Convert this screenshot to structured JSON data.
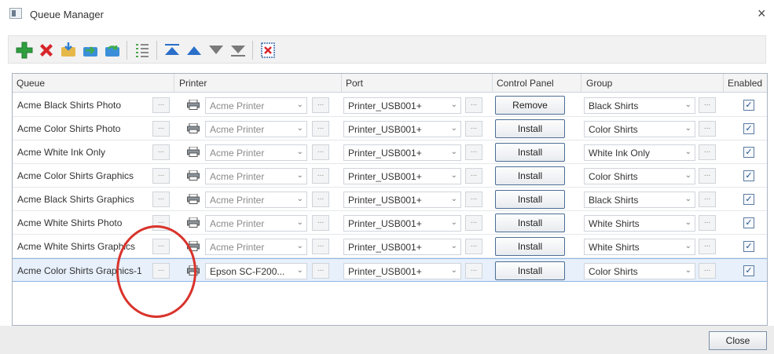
{
  "window": {
    "title": "Queue Manager",
    "close_glyph": "×"
  },
  "toolbar": {
    "icons": [
      "add-icon",
      "delete-icon",
      "import-icon",
      "export-icon",
      "refresh-icon",
      "list-icon",
      "move-top-icon",
      "move-up-icon",
      "move-down-icon",
      "move-bottom-icon",
      "clear-icon"
    ]
  },
  "columns": {
    "queue": "Queue",
    "printer": "Printer",
    "port": "Port",
    "control_panel": "Control Panel",
    "group": "Group",
    "enabled": "Enabled"
  },
  "rows": [
    {
      "queue": "Acme Black Shirts Photo",
      "printer": "Acme Printer",
      "port": "Printer_USB001+",
      "action": "Remove",
      "group": "Black Shirts",
      "enabled": true
    },
    {
      "queue": "Acme Color Shirts Photo",
      "printer": "Acme Printer",
      "port": "Printer_USB001+",
      "action": "Install",
      "group": "Color Shirts",
      "enabled": true
    },
    {
      "queue": "Acme White Ink Only",
      "printer": "Acme Printer",
      "port": "Printer_USB001+",
      "action": "Install",
      "group": "White Ink Only",
      "enabled": true
    },
    {
      "queue": "Acme Color Shirts Graphics",
      "printer": "Acme Printer",
      "port": "Printer_USB001+",
      "action": "Install",
      "group": "Color Shirts",
      "enabled": true
    },
    {
      "queue": "Acme Black Shirts Graphics",
      "printer": "Acme Printer",
      "port": "Printer_USB001+",
      "action": "Install",
      "group": "Black Shirts",
      "enabled": true
    },
    {
      "queue": "Acme White Shirts Photo",
      "printer": "Acme Printer",
      "port": "Printer_USB001+",
      "action": "Install",
      "group": "White Shirts",
      "enabled": true
    },
    {
      "queue": "Acme White Shirts Graphics",
      "printer": "Acme Printer",
      "port": "Printer_USB001+",
      "action": "Install",
      "group": "White Shirts",
      "enabled": true
    },
    {
      "queue": "Acme Color Shirts Graphics-1",
      "printer": "Epson SC-F200...",
      "port": "Printer_USB001+",
      "action": "Install",
      "group": "Color Shirts",
      "enabled": true
    }
  ],
  "ellipsis": "...",
  "check_glyph": "✓",
  "dropdown_glyph": "⌄",
  "footer": {
    "close_label": "Close"
  },
  "colors": {
    "accent_red": "#d9332b",
    "selection": "#e7f0fb",
    "button_border": "#4d6d94"
  }
}
